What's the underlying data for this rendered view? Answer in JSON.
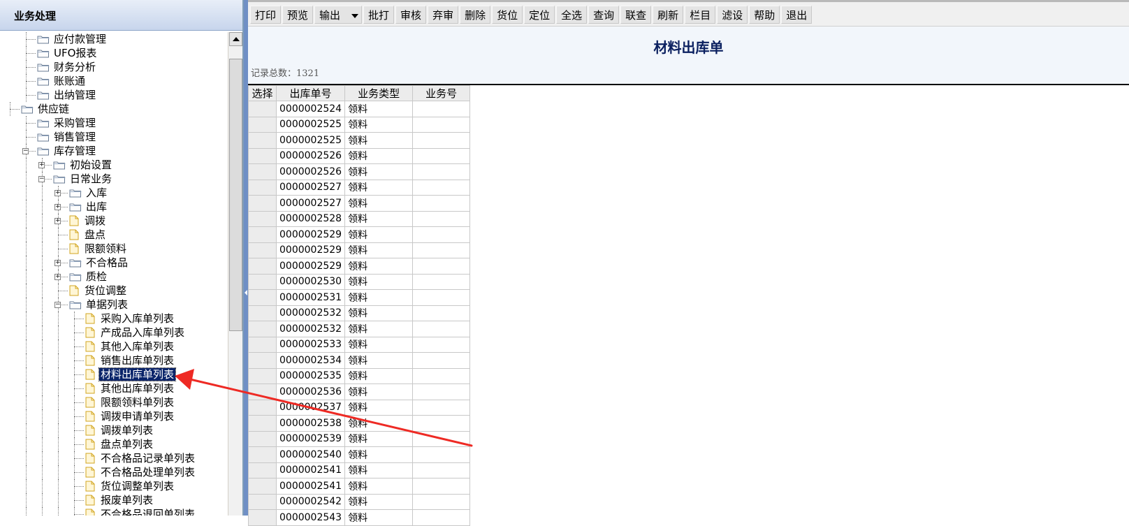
{
  "left_panel": {
    "header": "业务处理",
    "tree": [
      {
        "label": "应付款管理",
        "icon": "folder-icon",
        "depth": 1,
        "expander": ""
      },
      {
        "label": "UFO报表",
        "icon": "folder-icon",
        "depth": 1,
        "expander": ""
      },
      {
        "label": "财务分析",
        "icon": "folder-icon",
        "depth": 1,
        "expander": ""
      },
      {
        "label": "账账通",
        "icon": "folder-icon",
        "depth": 1,
        "expander": ""
      },
      {
        "label": "出纳管理",
        "icon": "folder-icon",
        "depth": 1,
        "expander": ""
      },
      {
        "label": "供应链",
        "icon": "folder-icon",
        "depth": 0,
        "expander": ""
      },
      {
        "label": "采购管理",
        "icon": "folder-icon",
        "depth": 1,
        "expander": ""
      },
      {
        "label": "销售管理",
        "icon": "folder-icon",
        "depth": 1,
        "expander": ""
      },
      {
        "label": "库存管理",
        "icon": "folder-icon",
        "depth": 1,
        "expander": "-"
      },
      {
        "label": "初始设置",
        "icon": "folder-icon",
        "depth": 2,
        "expander": "+"
      },
      {
        "label": "日常业务",
        "icon": "folder-icon",
        "depth": 2,
        "expander": "-"
      },
      {
        "label": "入库",
        "icon": "folder-icon",
        "depth": 3,
        "expander": "+"
      },
      {
        "label": "出库",
        "icon": "folder-icon",
        "depth": 3,
        "expander": "+"
      },
      {
        "label": "调拨",
        "icon": "document-icon",
        "depth": 3,
        "expander": "+"
      },
      {
        "label": "盘点",
        "icon": "document-icon",
        "depth": 3,
        "expander": ""
      },
      {
        "label": "限额领料",
        "icon": "document-icon",
        "depth": 3,
        "expander": ""
      },
      {
        "label": "不合格品",
        "icon": "folder-icon",
        "depth": 3,
        "expander": "+"
      },
      {
        "label": "质检",
        "icon": "folder-icon",
        "depth": 3,
        "expander": "+"
      },
      {
        "label": "货位调整",
        "icon": "document-icon",
        "depth": 3,
        "expander": ""
      },
      {
        "label": "单据列表",
        "icon": "folder-icon",
        "depth": 3,
        "expander": "-"
      },
      {
        "label": "采购入库单列表",
        "icon": "document-icon",
        "depth": 4,
        "expander": ""
      },
      {
        "label": "产成品入库单列表",
        "icon": "document-icon",
        "depth": 4,
        "expander": ""
      },
      {
        "label": "其他入库单列表",
        "icon": "document-icon",
        "depth": 4,
        "expander": ""
      },
      {
        "label": "销售出库单列表",
        "icon": "document-icon",
        "depth": 4,
        "expander": ""
      },
      {
        "label": "材料出库单列表",
        "icon": "document-icon",
        "depth": 4,
        "expander": "",
        "selected": true
      },
      {
        "label": "其他出库单列表",
        "icon": "document-icon",
        "depth": 4,
        "expander": ""
      },
      {
        "label": "限额领料单列表",
        "icon": "document-icon",
        "depth": 4,
        "expander": ""
      },
      {
        "label": "调拨申请单列表",
        "icon": "document-icon",
        "depth": 4,
        "expander": ""
      },
      {
        "label": "调拨单列表",
        "icon": "document-icon",
        "depth": 4,
        "expander": ""
      },
      {
        "label": "盘点单列表",
        "icon": "document-icon",
        "depth": 4,
        "expander": ""
      },
      {
        "label": "不合格品记录单列表",
        "icon": "document-icon",
        "depth": 4,
        "expander": ""
      },
      {
        "label": "不合格品处理单列表",
        "icon": "document-icon",
        "depth": 4,
        "expander": ""
      },
      {
        "label": "货位调整单列表",
        "icon": "document-icon",
        "depth": 4,
        "expander": ""
      },
      {
        "label": "报废单列表",
        "icon": "document-icon",
        "depth": 4,
        "expander": ""
      },
      {
        "label": "不合格品退回单列表",
        "icon": "document-icon",
        "depth": 4,
        "expander": ""
      }
    ]
  },
  "toolbar": {
    "buttons": [
      "打印",
      "预览",
      "输出",
      "批打",
      "审核",
      "弃审",
      "删除",
      "货位",
      "定位",
      "全选",
      "查询",
      "联查",
      "刷新",
      "栏目",
      "滤设",
      "帮助",
      "退出"
    ]
  },
  "main": {
    "title": "材料出库单",
    "record_count": "记录总数：1321",
    "columns": [
      "选择",
      "出库单号",
      "业务类型",
      "业务号"
    ],
    "rows": [
      [
        "",
        "0000002524",
        "领料",
        ""
      ],
      [
        "",
        "0000002525",
        "领料",
        ""
      ],
      [
        "",
        "0000002525",
        "领料",
        ""
      ],
      [
        "",
        "0000002526",
        "领料",
        ""
      ],
      [
        "",
        "0000002526",
        "领料",
        ""
      ],
      [
        "",
        "0000002527",
        "领料",
        ""
      ],
      [
        "",
        "0000002527",
        "领料",
        ""
      ],
      [
        "",
        "0000002528",
        "领料",
        ""
      ],
      [
        "",
        "0000002529",
        "领料",
        ""
      ],
      [
        "",
        "0000002529",
        "领料",
        ""
      ],
      [
        "",
        "0000002529",
        "领料",
        ""
      ],
      [
        "",
        "0000002530",
        "领料",
        ""
      ],
      [
        "",
        "0000002531",
        "领料",
        ""
      ],
      [
        "",
        "0000002532",
        "领料",
        ""
      ],
      [
        "",
        "0000002532",
        "领料",
        ""
      ],
      [
        "",
        "0000002533",
        "领料",
        ""
      ],
      [
        "",
        "0000002534",
        "领料",
        ""
      ],
      [
        "",
        "0000002535",
        "领料",
        ""
      ],
      [
        "",
        "0000002536",
        "领料",
        ""
      ],
      [
        "",
        "0000002537",
        "领料",
        ""
      ],
      [
        "",
        "0000002538",
        "领料",
        ""
      ],
      [
        "",
        "0000002539",
        "领料",
        ""
      ],
      [
        "",
        "0000002540",
        "领料",
        ""
      ],
      [
        "",
        "0000002541",
        "领料",
        ""
      ],
      [
        "",
        "0000002541",
        "领料",
        ""
      ],
      [
        "",
        "0000002542",
        "领料",
        ""
      ],
      [
        "",
        "0000002543",
        "领料",
        ""
      ]
    ]
  },
  "annotation": {
    "arrow_color": "#ee2a24"
  },
  "colors": {
    "selected_bg": "#0a246a",
    "title_color": "#0a1f5f",
    "splitter": "#6f8fc5"
  }
}
